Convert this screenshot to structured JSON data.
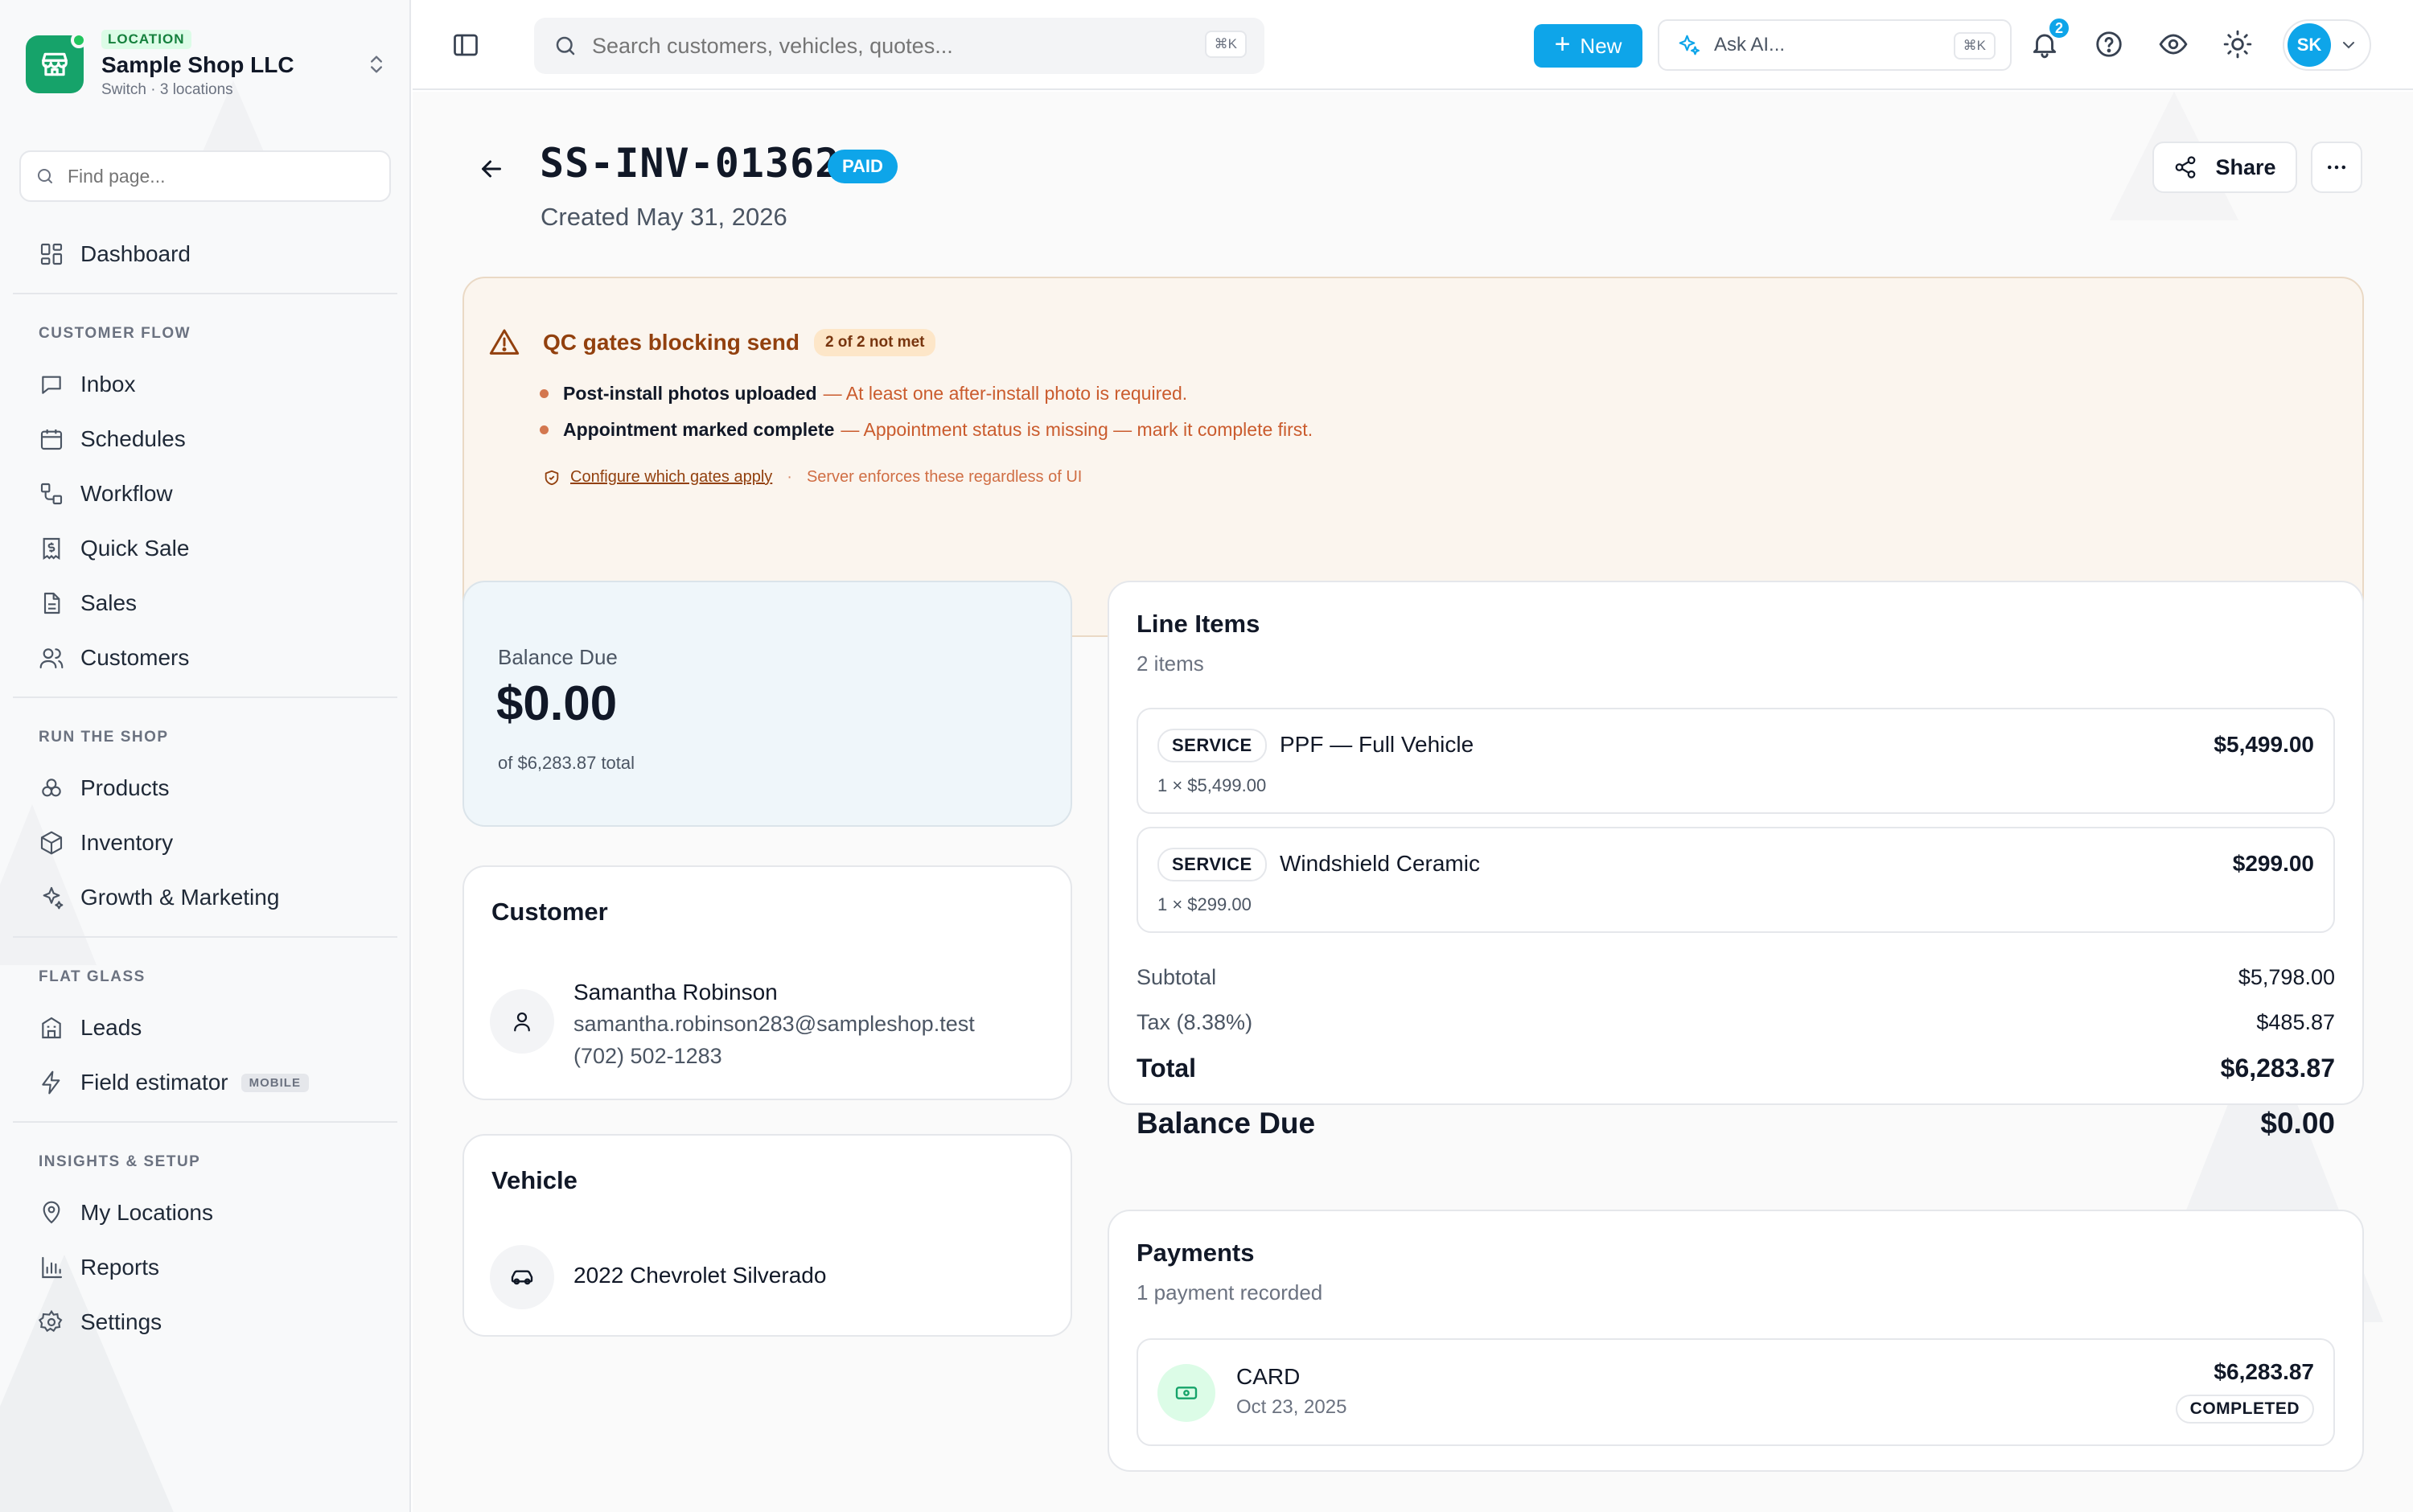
{
  "location": {
    "badge": "LOCATION",
    "name": "Sample Shop LLC",
    "sub": "Switch · 3 locations"
  },
  "sidebar": {
    "find_placeholder": "Find page...",
    "dashboard": "Dashboard",
    "sections": {
      "customer_flow": "CUSTOMER FLOW",
      "run_the_shop": "RUN THE SHOP",
      "flat_glass": "FLAT GLASS",
      "insights": "INSIGHTS & SETUP"
    },
    "items": {
      "inbox": "Inbox",
      "schedules": "Schedules",
      "workflow": "Workflow",
      "quick_sale": "Quick Sale",
      "sales": "Sales",
      "customers": "Customers",
      "products": "Products",
      "inventory": "Inventory",
      "growth": "Growth & Marketing",
      "leads": "Leads",
      "field_estimator": "Field estimator",
      "field_estimator_badge": "MOBILE",
      "my_locations": "My Locations",
      "reports": "Reports",
      "settings": "Settings"
    }
  },
  "topbar": {
    "search_placeholder": "Search customers, vehicles, quotes...",
    "search_shortcut": "⌘K",
    "new_label": "New",
    "ask_ai_label": "Ask AI...",
    "ask_ai_shortcut": "⌘K",
    "notification_count": "2",
    "avatar_initials": "SK"
  },
  "invoice": {
    "number": "SS-INV-01362",
    "status": "PAID",
    "created": "Created May 31, 2026",
    "share_label": "Share"
  },
  "qc": {
    "title": "QC gates blocking send",
    "count": "2 of 2 not met",
    "items": [
      {
        "label": "Post-install photos uploaded",
        "desc": "— At least one after-install photo is required."
      },
      {
        "label": "Appointment marked complete",
        "desc": "— Appointment status is missing — mark it complete first."
      }
    ],
    "configure_link": "Configure which gates apply",
    "separator": "·",
    "note": "Server enforces these regardless of UI"
  },
  "balance": {
    "label": "Balance Due",
    "amount": "$0.00",
    "of_total": "of $6,283.87 total"
  },
  "customer": {
    "title": "Customer",
    "name": "Samantha Robinson",
    "email": "samantha.robinson283@sampleshop.test",
    "phone": "(702) 502-1283"
  },
  "vehicle": {
    "title": "Vehicle",
    "name": "2022 Chevrolet Silverado"
  },
  "line_items": {
    "title": "Line Items",
    "count": "2 items",
    "items": [
      {
        "tag": "SERVICE",
        "name": "PPF — Full Vehicle",
        "qty": "1 × $5,499.00",
        "price": "$5,499.00"
      },
      {
        "tag": "SERVICE",
        "name": "Windshield Ceramic",
        "qty": "1 × $299.00",
        "price": "$299.00"
      }
    ],
    "subtotal_label": "Subtotal",
    "subtotal": "$5,798.00",
    "tax_label": "Tax (8.38%)",
    "tax": "$485.87",
    "total_label": "Total",
    "total": "$6,283.87",
    "balance_label": "Balance Due",
    "balance": "$0.00"
  },
  "payments": {
    "title": "Payments",
    "count": "1 payment recorded",
    "items": [
      {
        "method": "CARD",
        "date": "Oct 23, 2025",
        "amount": "$6,283.87",
        "status": "COMPLETED"
      }
    ]
  },
  "colors": {
    "accent": "#0ea5e9",
    "brand_green": "#16a36a",
    "warning_text": "#92400e"
  }
}
